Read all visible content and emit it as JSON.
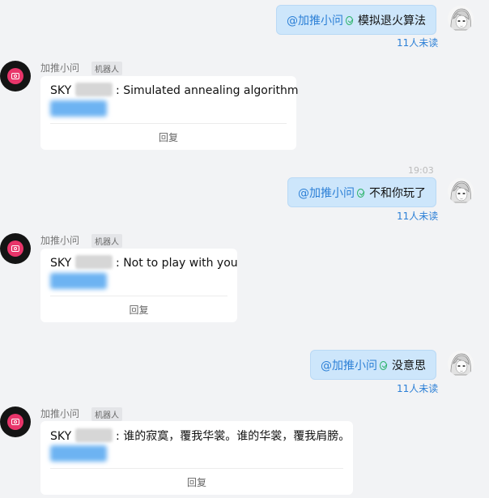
{
  "sent_messages": [
    {
      "mention": "@加推小问",
      "text": "模拟退火算法",
      "unread": "11人未读"
    },
    {
      "mention": "@加推小问",
      "text": "不和你玩了",
      "unread": "11人未读"
    },
    {
      "mention": "@加推小问",
      "text": "没意思",
      "unread": "11人未读"
    }
  ],
  "bot_messages": [
    {
      "sender": "加推小问",
      "tag": "机器人",
      "prefix": "SKY",
      "text": ": Simulated annealing algorithm",
      "reply": "回复"
    },
    {
      "sender": "加推小问",
      "tag": "机器人",
      "prefix": "SKY",
      "text": ": Not to play with you",
      "reply": "回复"
    },
    {
      "sender": "加推小问",
      "tag": "机器人",
      "prefix": "SKY",
      "text": ": 谁的寂寞，覆我华裳。谁的华裳，覆我肩膀。",
      "reply": "回复"
    }
  ],
  "timestamp": "19:03",
  "icons": {
    "user_avatar": "anime-girl-avatar-icon",
    "bot_avatar": "camera-icon",
    "verified": "check-circle-icon"
  }
}
